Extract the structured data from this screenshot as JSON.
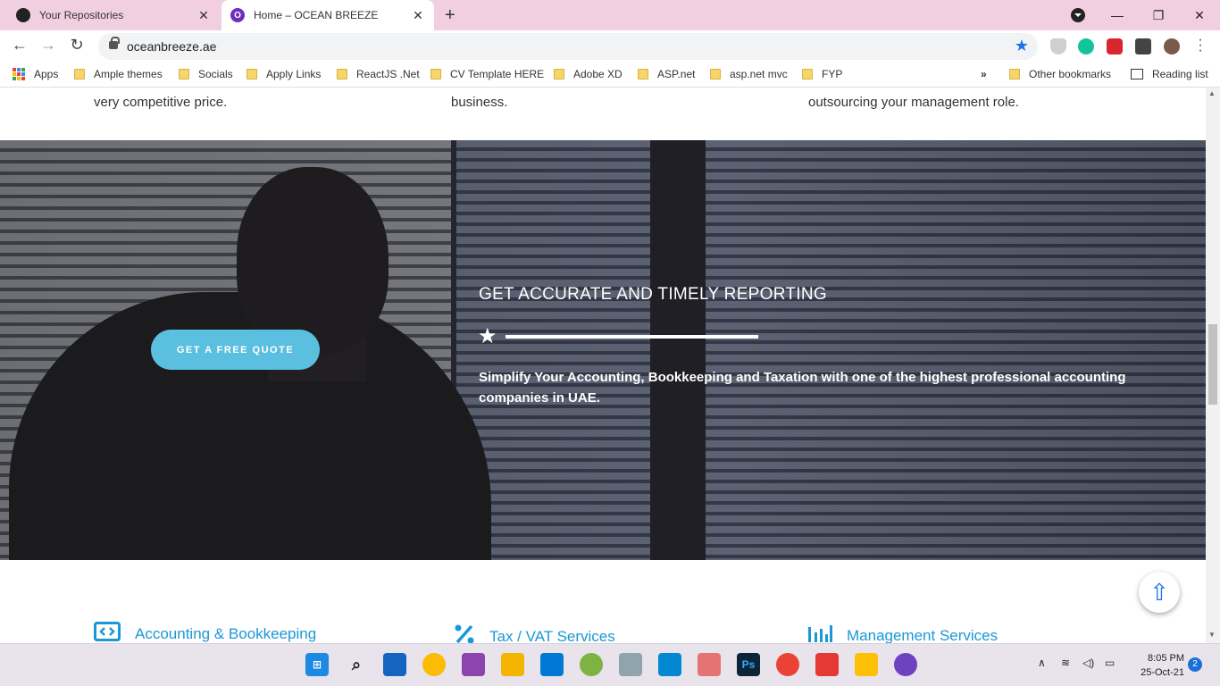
{
  "browser": {
    "tabs": [
      {
        "title": "Your Repositories"
      },
      {
        "title": "Home – OCEAN BREEZE"
      }
    ],
    "url": "oceanbreeze.ae",
    "bookmarks": [
      "Apps",
      "Ample themes",
      "Socials",
      "Apply Links",
      "ReactJS .Net",
      "CV Template HERE",
      "Adobe XD",
      "ASP.net",
      "asp.net mvc",
      "FYP"
    ],
    "overflow": "»",
    "other_bookmarks": "Other bookmarks",
    "reading_list": "Reading list"
  },
  "page": {
    "top_snippets": [
      "very competitive price.",
      "business.",
      "outsourcing your management role."
    ],
    "hero": {
      "button": "GET A FREE QUOTE",
      "title": "GET ACCURATE AND TIMELY REPORTING",
      "description": "Simplify Your Accounting, Bookkeeping and Taxation with one of the highest professional accounting companies in UAE."
    },
    "services": [
      {
        "label": "Accounting & Bookkeeping",
        "icon": "code-window-icon"
      },
      {
        "label": "Tax / VAT Services",
        "icon": "percent-icon"
      },
      {
        "label": "Management Services",
        "icon": "bar-chart-icon"
      }
    ]
  },
  "taskbar": {
    "time": "8:05 PM",
    "date": "25-Oct-21",
    "notifications": "2"
  },
  "colors": {
    "accent": "#1a98d5",
    "button": "#5bbfe0",
    "tabstrip": "#f2cfe0"
  }
}
